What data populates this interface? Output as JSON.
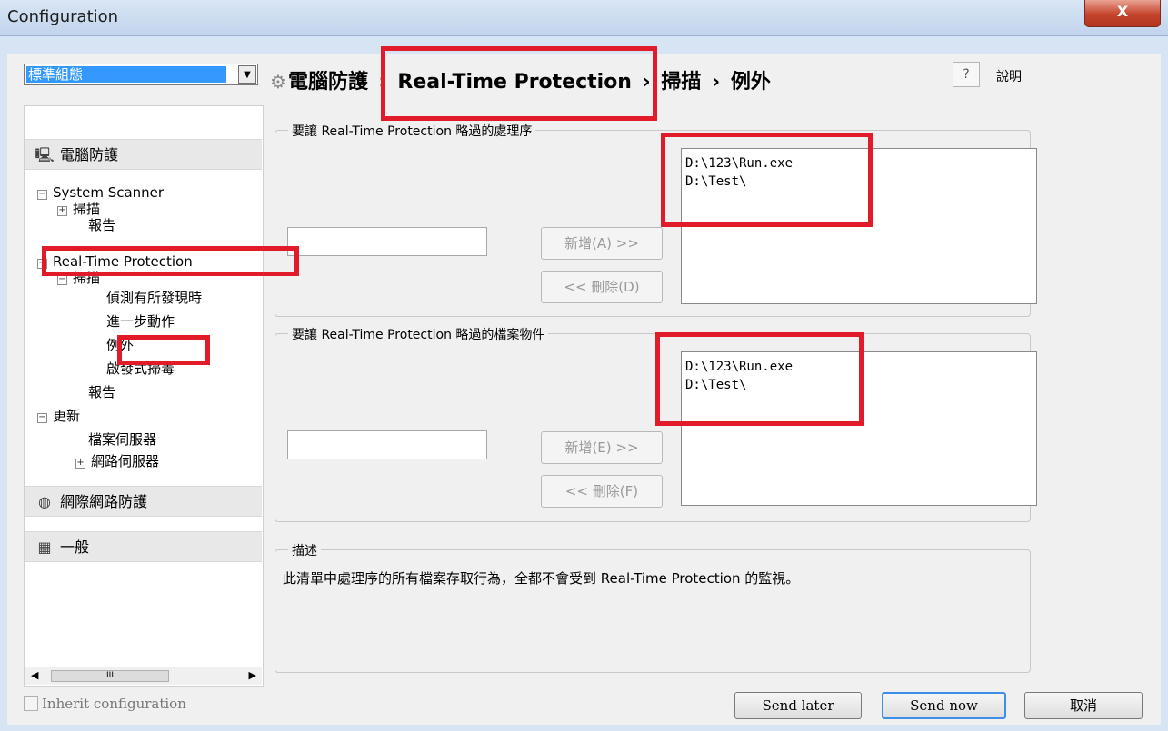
{
  "window": {
    "title": "Configuration",
    "close_label": "X"
  },
  "profile": {
    "selected": "標準組態",
    "arrow": "▼"
  },
  "breadcrumb": {
    "gear_icon": "gear-icon",
    "level1": "電腦防護",
    "level2": "Real-Time Protection",
    "level3": "掃描",
    "level4": "例外",
    "separator": "›"
  },
  "help": {
    "icon": "?",
    "label": "說明"
  },
  "tree": {
    "categories": [
      {
        "label": "電腦防護",
        "icon": "monitor-icon"
      },
      {
        "label": "網際網路防護",
        "icon": "globe-icon"
      },
      {
        "label": "一般",
        "icon": "calendar-icon"
      }
    ],
    "nodes": {
      "system_scanner": "System Scanner",
      "ss_scan": "掃描",
      "ss_report": "報告",
      "rtp": "Real-Time Protection",
      "rtp_scan": "掃描",
      "rtp_detect": "偵測有所發現時",
      "rtp_further": "進一步動作",
      "rtp_exceptions": "例外",
      "rtp_heuristic": "啟發式掃毒",
      "rtp_report": "報告",
      "update": "更新",
      "file_server": "檔案伺服器",
      "web_server": "網路伺服器"
    },
    "expand_minus": "−",
    "expand_plus": "+",
    "scroll_thumb": "III"
  },
  "processes_group": {
    "legend": "要讓 Real-Time Protection 略過的處理序",
    "input_value": "",
    "add_button": "新增(A) >>",
    "delete_button": "<< 刪除(D)",
    "list": [
      "D:\\123\\Run.exe",
      "D:\\Test\\"
    ]
  },
  "objects_group": {
    "legend": "要讓 Real-Time Protection 略過的檔案物件",
    "input_value": "",
    "add_button": "新增(E) >>",
    "delete_button": "<< 刪除(F)",
    "list": [
      "D:\\123\\Run.exe",
      "D:\\Test\\"
    ]
  },
  "description": {
    "legend": "描述",
    "text": "此清單中處理序的所有檔案存取行為，全都不會受到 Real-Time Protection 的監視。"
  },
  "footer": {
    "inherit_label": "Inherit configuration",
    "send_later": "Send later",
    "send_now": "Send now",
    "cancel": "取消"
  },
  "colors": {
    "annotation": "#e21b2b",
    "selection": "#3399ff"
  }
}
